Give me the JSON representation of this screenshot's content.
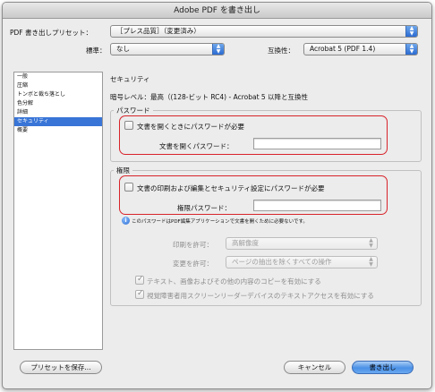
{
  "window": {
    "title": "Adobe PDF を書き出し"
  },
  "preset_row": {
    "label": "PDF 書き出しプリセット：",
    "value": "［プレス品質］（変更済み）"
  },
  "standard_row": {
    "label": "標準：",
    "value": "なし",
    "compat_label": "互換性：",
    "compat_value": "Acrobat 5 (PDF 1.4)"
  },
  "sidebar": {
    "items": [
      {
        "label": "一般",
        "selected": false
      },
      {
        "label": "圧縮",
        "selected": false
      },
      {
        "label": "トンボと裁ち落とし",
        "selected": false
      },
      {
        "label": "色分解",
        "selected": false
      },
      {
        "label": "詳細",
        "selected": false
      },
      {
        "label": "セキュリティ",
        "selected": true
      },
      {
        "label": "概要",
        "selected": false
      }
    ]
  },
  "main": {
    "heading": "セキュリティ",
    "encryption": "暗号レベル：高",
    "encryption_text": "暗号レベル：最高（(128-ビット RC4) - Acrobat 5 以降と互換性",
    "password_group": {
      "title": "パスワード",
      "require_open_label": "文書を開くときにパスワードが必要",
      "require_open_checked": false,
      "open_password_label": "文書を開くパスワード：",
      "open_password_value": ""
    },
    "permissions_group": {
      "title": "権限",
      "require_perm_label": "文書の印刷および編集とセキュリティ設定にパスワードが必要",
      "require_perm_checked": false,
      "perm_password_label": "権限パスワード：",
      "perm_password_value": "",
      "info_text": "このパスワードはPDF編集アプリケーションで文書を開くために必要ないです。",
      "print_label": "印刷を許可：",
      "print_value": "高解像度",
      "change_label": "変更を許可：",
      "change_value": "ページの抽出を除くすべての操作",
      "copy_label": "テキスト、画像およびその他の内容のコピーを有効にする",
      "copy_checked": true,
      "access_label": "視覚障害者用スクリーンリーダーデバイスのテキストアクセスを有効にする",
      "access_checked": true
    }
  },
  "footer": {
    "save_preset": "プリセットを保存...",
    "cancel": "キャンセル",
    "export": "書き出し"
  },
  "colors": {
    "highlight": "#d8232a",
    "selection": "#3875d7",
    "primary_button": "#4a90e6"
  },
  "icons": [
    "popup-arrows-icon",
    "info-icon",
    "checkmark-icon"
  ]
}
